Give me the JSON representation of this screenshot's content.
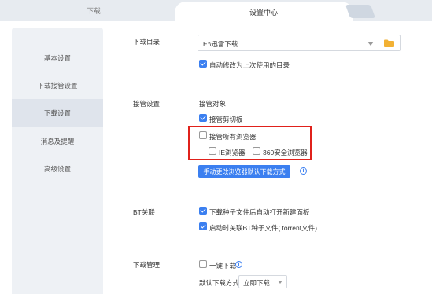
{
  "tabs": {
    "download": "下载",
    "settings_center": "设置中心"
  },
  "sidebar": {
    "items": [
      {
        "label": "基本设置"
      },
      {
        "label": "下载接管设置"
      },
      {
        "label": "下载设置"
      },
      {
        "label": "消息及提醒"
      },
      {
        "label": "高级设置"
      }
    ],
    "active_index": 2
  },
  "download_dir": {
    "label": "下载目录",
    "value": "E:\\迅雷下载",
    "auto_change": {
      "label": "自动修改为上次使用的目录",
      "checked": true
    }
  },
  "takeover": {
    "label": "接管设置",
    "object_label": "接管对象",
    "clipboard": {
      "label": "接管剪切板",
      "checked": true
    },
    "all_browsers": {
      "label": "接管所有浏览器",
      "checked": false
    },
    "ie": {
      "label": "IE浏览器",
      "checked": false
    },
    "browser360": {
      "label": "360安全浏览器",
      "checked": false
    },
    "manual_button": "手动更改浏览器默认下载方式",
    "info_glyph": "i"
  },
  "bt": {
    "label": "BT关联",
    "auto_open": {
      "label": "下载种子文件后自动打开新建面板",
      "checked": true
    },
    "associate": {
      "label": "启动时关联BT种子文件(.torrent文件)",
      "checked": true
    }
  },
  "manage": {
    "label": "下载管理",
    "one_click": {
      "label": "一键下载",
      "checked": false
    },
    "default_method_label": "默认下载方式",
    "default_method_value": "立即下载"
  },
  "colors": {
    "accent": "#3b7ff0",
    "highlight": "#e0211b",
    "folder": "#f2b134"
  }
}
